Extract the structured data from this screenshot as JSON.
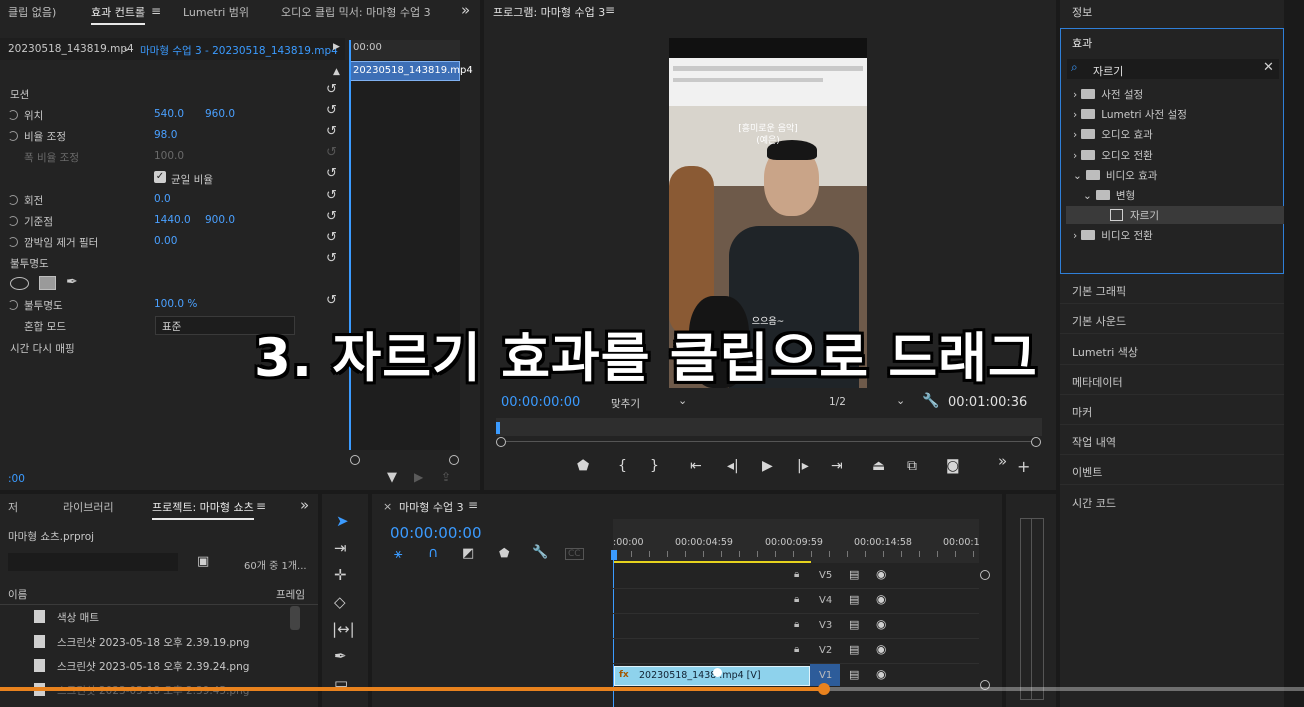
{
  "effect_controls": {
    "tabs": [
      "클립 없음)",
      "효과 컨트롤",
      "Lumetri 범위",
      "오디오 클립 믹서: 마마형 수업 3"
    ],
    "more": "»",
    "source_clip": "20230518_143819.mp4",
    "sequence_clip": "마마형 수업 3 - 20230518_143819.mp4",
    "mini_timecode": "00:00",
    "mini_clip": "20230518_143819.mp4",
    "motion": "모션",
    "position_label": "위치",
    "position_x": "540.0",
    "position_y": "960.0",
    "scale_label": "비율 조정",
    "scale_value": "98.0",
    "scale_width_label": "폭 비율 조정",
    "scale_width_value": "100.0",
    "uniform_label": "균일 비율",
    "rotation_label": "회전",
    "rotation_value": "0.0",
    "anchor_label": "기준점",
    "anchor_x": "1440.0",
    "anchor_y": "900.0",
    "flicker_label": "깜박임 제거 필터",
    "flicker_value": "0.00",
    "opacity_section": "불투명도",
    "opacity_label": "불투명도",
    "opacity_value": "100.0 %",
    "blend_label": "혼합 모드",
    "blend_value": "표준",
    "time_remap": "시간 다시 매핑",
    "bottom_timecode": ":00"
  },
  "program": {
    "title": "프로그램: 마마형 수업 3",
    "caption_top": "[흥미로운 음악]",
    "caption_top2": "(예은)",
    "caption_bottom": "으으음~",
    "timecode": "00:00:00:00",
    "fit": "맞추기",
    "quality": "1/2",
    "duration": "00:01:00:36",
    "more": "»"
  },
  "overlay_title": "3. 자르기 효과를 클립으로 드래그",
  "right_panel": {
    "info": "정보",
    "effects_title": "효과",
    "search_value": "자르기",
    "tree": [
      {
        "label": "사전 설정",
        "arrow": "›"
      },
      {
        "label": "Lumetri 사전 설정",
        "arrow": "›"
      },
      {
        "label": "오디오 효과",
        "arrow": "›"
      },
      {
        "label": "오디오 전환",
        "arrow": "›"
      },
      {
        "label": "비디오 효과",
        "arrow": "⌄"
      },
      {
        "label": "변형",
        "arrow": "⌄"
      },
      {
        "label": "자르기",
        "arrow": ""
      },
      {
        "label": "비디오 전환",
        "arrow": "›"
      }
    ],
    "panels": [
      "기본 그래픽",
      "기본 사운드",
      "Lumetri 색상",
      "메타데이터",
      "마커",
      "작업 내역",
      "이벤트",
      "시간 코드"
    ]
  },
  "project": {
    "tabs": [
      "저",
      "라이브러리",
      "프로젝트: 마마형 쇼츠"
    ],
    "more": "»",
    "file": "마마형 쇼츠.prproj",
    "count": "60개 중 1개...",
    "col_name": "이름",
    "col_frame": "프레임",
    "items": [
      "색상 매트",
      "스크린샷 2023-05-18 오후 2.39.19.png",
      "스크린샷 2023-05-18 오후 2.39.24.png",
      "스크린샷 2023-05-18 오후 2.39.45.png"
    ]
  },
  "timeline": {
    "title": "마마형 수업 3",
    "timecode": "00:00:00:00",
    "ruler": [
      ":00:00",
      "00:00:04:59",
      "00:00:09:59",
      "00:00:14:58",
      "00:00:1"
    ],
    "tracks": [
      "V5",
      "V4",
      "V3",
      "V2",
      "V1"
    ],
    "clip_label": "20230518_1438 .mp4 [V]",
    "clip_fx": "fx"
  },
  "colors": {
    "accent": "#3b9bff",
    "playhead": "#e8821e",
    "clip": "#8ed2ec",
    "work_area": "#e6d31e"
  }
}
